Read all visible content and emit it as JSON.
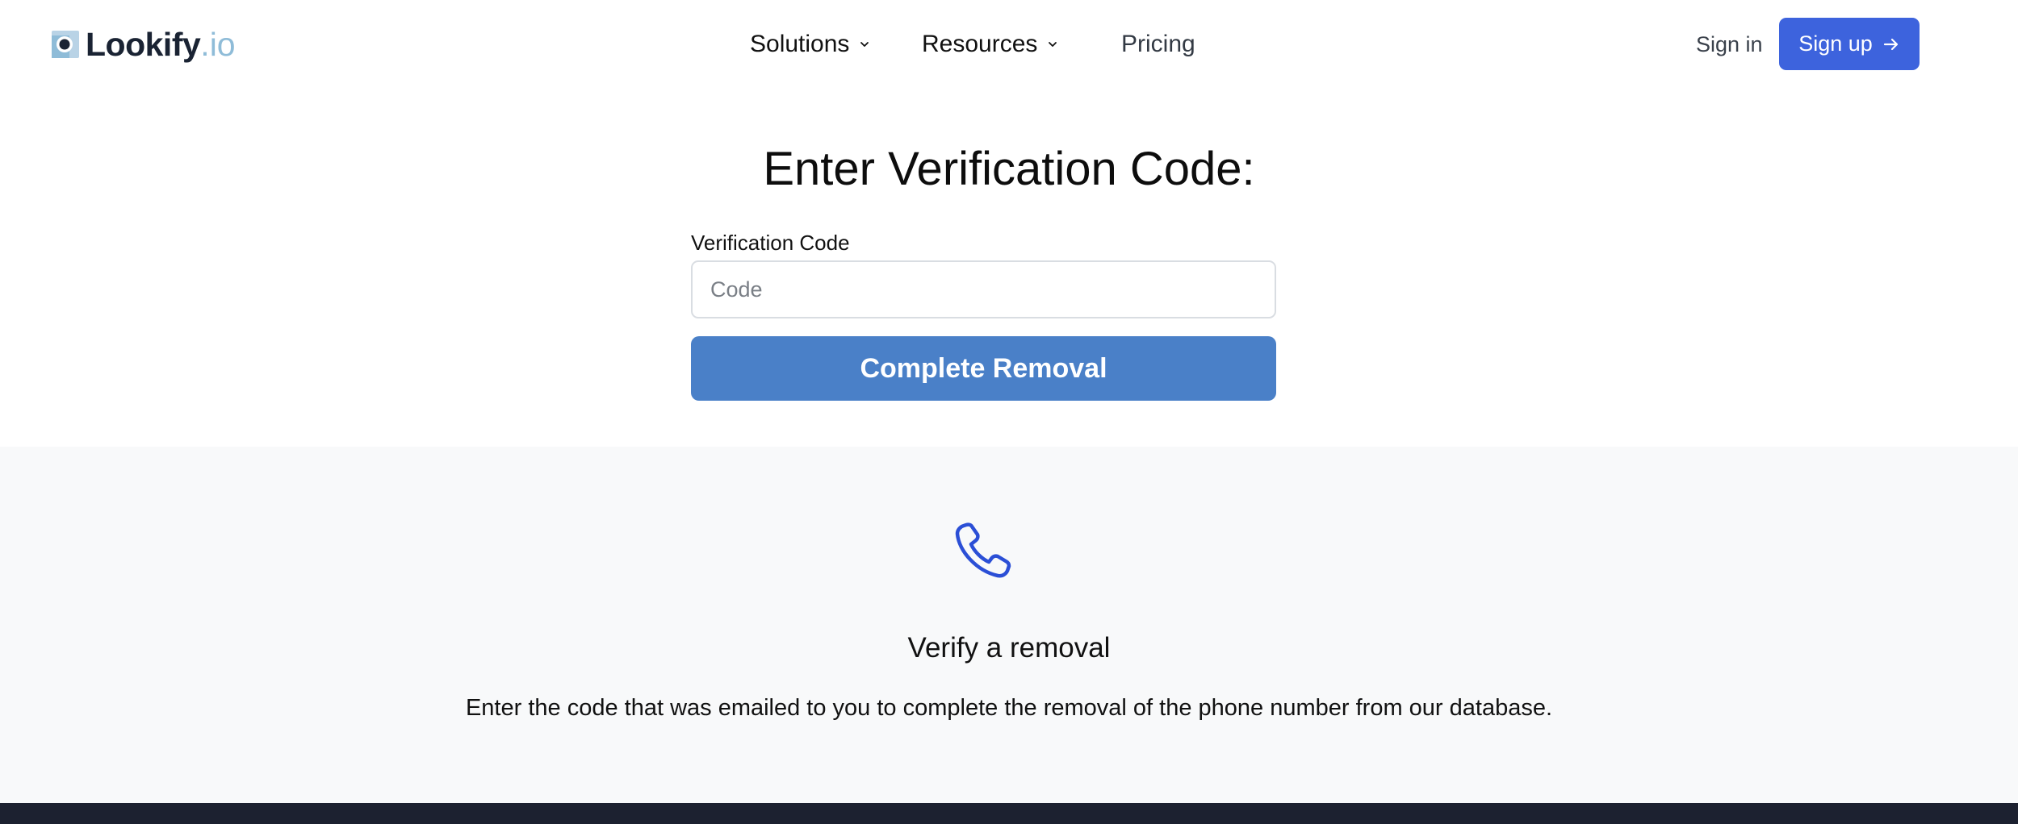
{
  "header": {
    "logo": {
      "name": "Lookify",
      "tld": ".io"
    },
    "nav": [
      {
        "label": "Solutions",
        "icon": "chevron-down-icon"
      },
      {
        "label": "Resources",
        "icon": "chevron-down-icon"
      },
      {
        "label": "Pricing"
      }
    ],
    "signin_label": "Sign in",
    "signup_label": "Sign up",
    "signup_icon": "arrow-right-icon"
  },
  "form": {
    "title": "Enter Verification Code:",
    "field_label": "Verification Code",
    "input_placeholder": "Code",
    "input_value": "",
    "submit_label": "Complete Removal"
  },
  "info": {
    "icon": "phone-icon",
    "title": "Verify a removal",
    "text": "Enter the code that was emailed to you to complete the removal of the phone number from our database."
  },
  "colors": {
    "primary_button": "#3d63dd",
    "submit_button": "#4a80c8",
    "phone_icon": "#2b4fd6",
    "info_background": "#f8f9fa",
    "footer_background": "#1c2130",
    "logo_tld": "#8fbcd8"
  }
}
